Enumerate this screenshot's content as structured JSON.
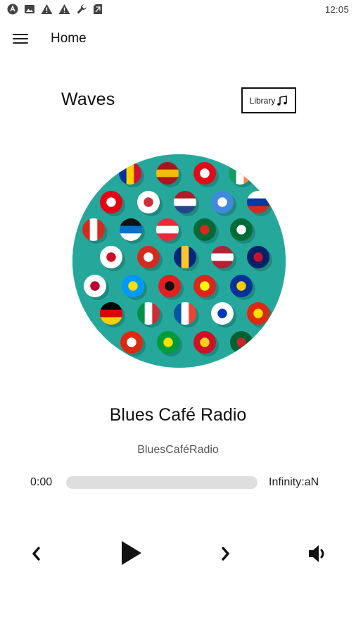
{
  "status_bar": {
    "time": "12:05",
    "icons": [
      "android-auto-icon",
      "image-icon",
      "warning-icon",
      "warning-icon",
      "wrench-icon",
      "sim-icon"
    ]
  },
  "app_bar": {
    "title": "Home",
    "menu_icon": "hamburger-menu-icon"
  },
  "header": {
    "brand": "Waves",
    "library_label": "Library",
    "library_icon": "music-note-icon"
  },
  "cover": {
    "description_icon": "country-flags-cover-image",
    "background_color": "#25a89b"
  },
  "station": {
    "name": "Blues Café Radio",
    "subtitle": "BluesCaféRadio"
  },
  "player": {
    "current_time": "0:00",
    "total_time": "Infinity:aN",
    "progress": 0,
    "controls": {
      "previous_icon": "chevron-left-icon",
      "play_icon": "play-icon",
      "next_icon": "chevron-right-icon",
      "volume_icon": "volume-icon"
    }
  }
}
